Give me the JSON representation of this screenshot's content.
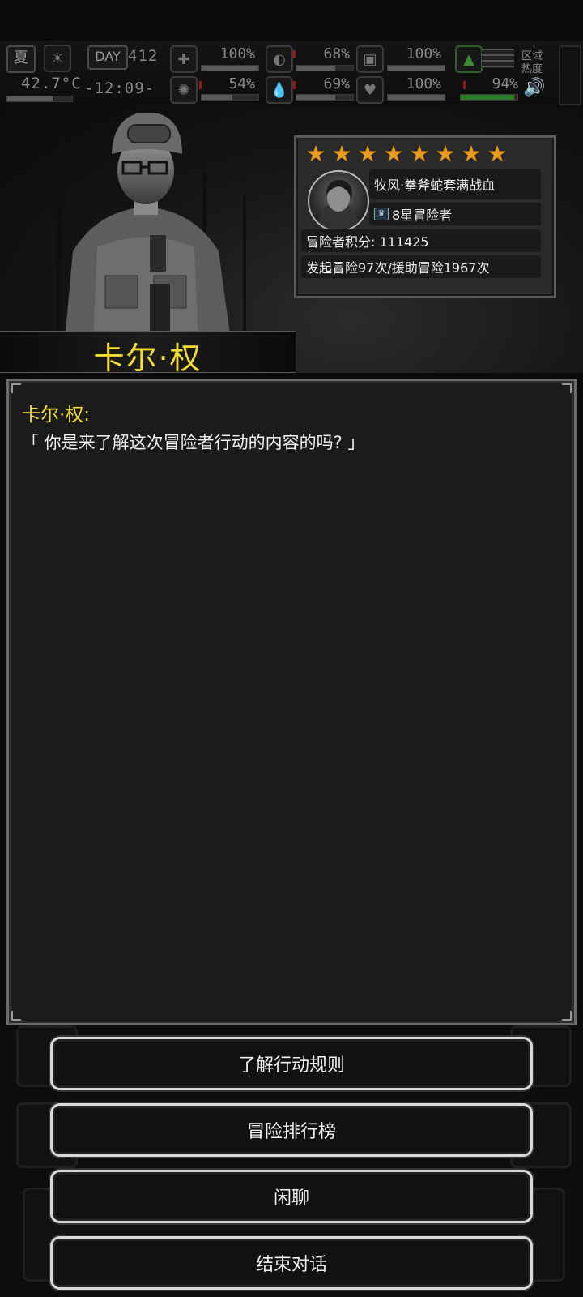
{
  "status": {
    "season": "夏",
    "day_label": "DAY",
    "day": "412",
    "temperature": "42.7°C",
    "time": "-12:09-",
    "pct_medkit": "100%",
    "pct_stomach": "68%",
    "pct_stamina": "100%",
    "pct_brain": "54%",
    "pct_water": "69%",
    "pct_heart": "100%",
    "pct_signal": "94%",
    "progress_medkit": 1.0,
    "progress_stomach": 0.68,
    "progress_stamina": 1.0,
    "progress_brain": 0.54,
    "progress_water": 0.69,
    "progress_heart": 1.0,
    "progress_signal": 0.94,
    "region_label": "区域\n热度"
  },
  "npc": {
    "name": "卡尔·权"
  },
  "adventurer": {
    "stars": 8,
    "player_name": "牧风·拳斧蛇套满战血",
    "rank": "8星冒险者",
    "score": "冒险者积分: 111425",
    "history": "发起冒险97次/援助冒险1967次"
  },
  "dialogue": {
    "speaker": "卡尔·权:",
    "text": "「 你是来了解这次冒险者行动的内容的吗? 」"
  },
  "options": {
    "rules": "了解行动规则",
    "leaderboard": "冒险排行榜",
    "chat": "闲聊",
    "end": "结束对话"
  },
  "colors": {
    "accent_yellow": "#f3dd2f",
    "star_orange": "#e89a1f",
    "bar_green": "#2f7d2a",
    "warn_red": "#a01414"
  }
}
